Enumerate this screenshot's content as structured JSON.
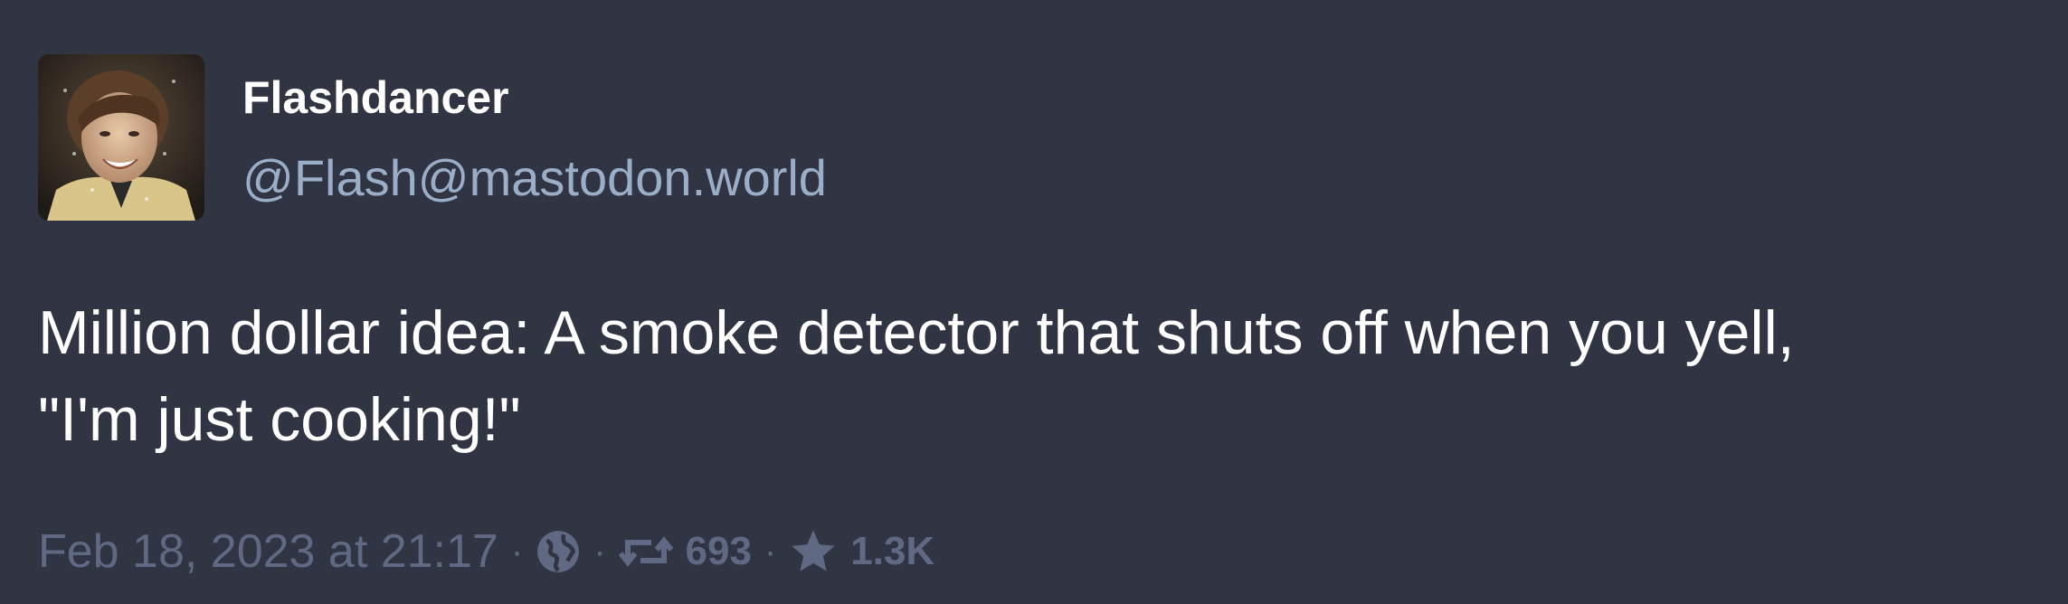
{
  "post": {
    "author": {
      "display_name": "Flashdancer",
      "handle": "@Flash@mastodon.world"
    },
    "content": {
      "line1": "Million dollar idea: A smoke detector that shuts off when you yell,",
      "line2": "\"I'm just cooking!\""
    },
    "meta": {
      "timestamp": "Feb 18, 2023 at 21:17",
      "separator": "·",
      "visibility_icon": "globe-icon",
      "boost_icon": "retweet-icon",
      "boost_count": "693",
      "favourite_icon": "star-icon",
      "favourite_count": "1.3K"
    }
  },
  "colors": {
    "background": "#313543",
    "primary_text": "#ffffff",
    "handle_text": "#9baec8",
    "meta_text": "#606984"
  }
}
